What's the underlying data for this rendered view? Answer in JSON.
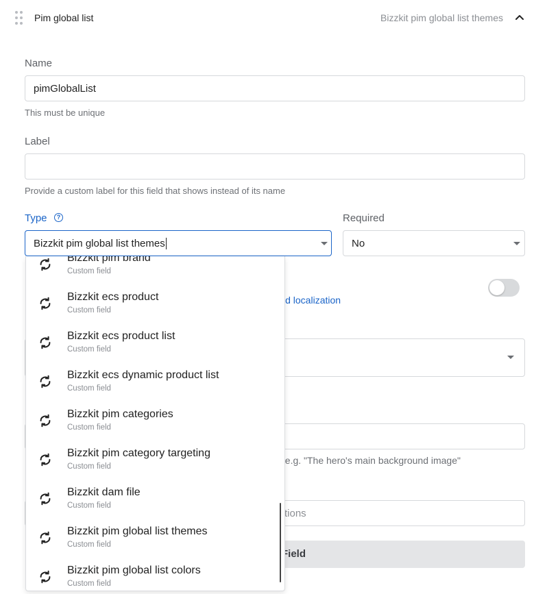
{
  "header": {
    "title": "Pim global list",
    "type_name": "Bizzkit pim global list themes"
  },
  "name_field": {
    "label": "Name",
    "value": "pimGlobalList",
    "help": "This must be unique"
  },
  "label_field": {
    "label": "Label",
    "value": "",
    "help": "Provide a custom label for this field that shows instead of its name"
  },
  "type_field": {
    "label": "Type",
    "help_icon": "question-circle-icon",
    "value": "Bizzkit pim global list themes"
  },
  "required_field": {
    "label": "Required",
    "value": "No"
  },
  "partial": {
    "localization_link": "ld localization",
    "description_hint": ", e.g. \"The hero's main background image\"",
    "options_placeholder": "tions",
    "add_field_button": "Field"
  },
  "dropdown": {
    "option_icon": "refresh-icon",
    "options": [
      {
        "title": "Bizzkit pim brand",
        "subtitle": "Custom field"
      },
      {
        "title": "Bizzkit ecs product",
        "subtitle": "Custom field"
      },
      {
        "title": "Bizzkit ecs product list",
        "subtitle": "Custom field"
      },
      {
        "title": "Bizzkit ecs dynamic product list",
        "subtitle": "Custom field"
      },
      {
        "title": "Bizzkit pim categories",
        "subtitle": "Custom field"
      },
      {
        "title": "Bizzkit pim category targeting",
        "subtitle": "Custom field"
      },
      {
        "title": "Bizzkit dam file",
        "subtitle": "Custom field"
      },
      {
        "title": "Bizzkit pim global list themes",
        "subtitle": "Custom field"
      },
      {
        "title": "Bizzkit pim global list colors",
        "subtitle": "Custom field"
      }
    ]
  },
  "colors": {
    "accent": "#1a64c8",
    "muted_text": "#8b8e93",
    "border": "#d6d8db"
  }
}
